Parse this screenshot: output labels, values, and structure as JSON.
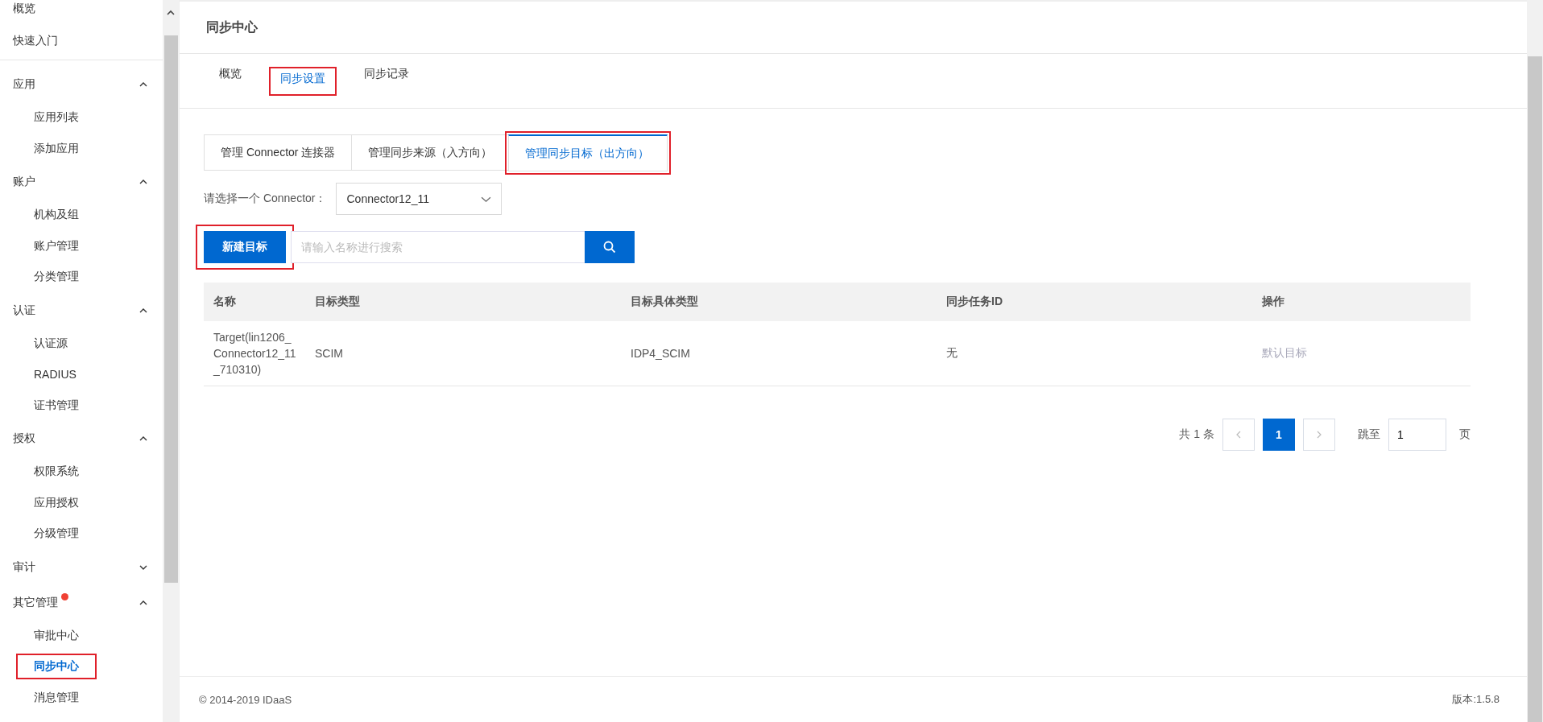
{
  "sidebar": {
    "top_items": [
      {
        "label": "概览"
      },
      {
        "label": "快速入门"
      }
    ],
    "groups": [
      {
        "label": "应用",
        "expanded": true,
        "badge": false,
        "items": [
          {
            "label": "应用列表",
            "selected": false,
            "highlighted": false
          },
          {
            "label": "添加应用",
            "selected": false,
            "highlighted": false
          }
        ]
      },
      {
        "label": "账户",
        "expanded": true,
        "badge": false,
        "items": [
          {
            "label": "机构及组",
            "selected": false,
            "highlighted": false
          },
          {
            "label": "账户管理",
            "selected": false,
            "highlighted": false
          },
          {
            "label": "分类管理",
            "selected": false,
            "highlighted": false
          }
        ]
      },
      {
        "label": "认证",
        "expanded": true,
        "badge": false,
        "items": [
          {
            "label": "认证源",
            "selected": false,
            "highlighted": false
          },
          {
            "label": "RADIUS",
            "selected": false,
            "highlighted": false
          },
          {
            "label": "证书管理",
            "selected": false,
            "highlighted": false
          }
        ]
      },
      {
        "label": "授权",
        "expanded": true,
        "badge": false,
        "items": [
          {
            "label": "权限系统",
            "selected": false,
            "highlighted": false
          },
          {
            "label": "应用授权",
            "selected": false,
            "highlighted": false
          },
          {
            "label": "分级管理",
            "selected": false,
            "highlighted": false
          }
        ]
      },
      {
        "label": "审计",
        "expanded": false,
        "badge": false
      },
      {
        "label": "其它管理",
        "expanded": true,
        "badge": true,
        "items": [
          {
            "label": "审批中心",
            "selected": false,
            "highlighted": false
          },
          {
            "label": "同步中心",
            "selected": true,
            "highlighted": true
          },
          {
            "label": "消息管理",
            "selected": false,
            "highlighted": false
          }
        ]
      }
    ]
  },
  "page": {
    "title": "同步中心",
    "tabs": [
      {
        "label": "概览",
        "selected": false,
        "highlighted": false
      },
      {
        "label": "同步设置",
        "selected": true,
        "highlighted": true
      },
      {
        "label": "同步记录",
        "selected": false,
        "highlighted": false
      }
    ],
    "sub_tabs": [
      {
        "label": "管理 Connector 连接器",
        "selected": false,
        "highlighted": false
      },
      {
        "label": "管理同步来源（入方向）",
        "selected": false,
        "highlighted": false
      },
      {
        "label": "管理同步目标（出方向）",
        "selected": true,
        "highlighted": true
      }
    ],
    "connector_label": "请选择一个 Connector：",
    "connector_value": "Connector12_11",
    "new_button": {
      "label": "新建目标",
      "highlighted": true
    },
    "search": {
      "placeholder": "请输入名称进行搜索"
    },
    "table": {
      "columns": [
        "名称",
        "目标类型",
        "目标具体类型",
        "同步任务ID",
        "操作"
      ],
      "rows": [
        {
          "cells": [
            "Target(lin1206_Connector12_11_710310)",
            "SCIM",
            "IDP4_SCIM",
            "无"
          ],
          "action": "默认目标"
        }
      ]
    },
    "pagination": {
      "total": "共 1 条",
      "pages": [
        {
          "label": "1",
          "selected": true
        }
      ],
      "jump_label": "跳至",
      "jump_value": "1",
      "page_unit": "页"
    }
  },
  "footer": {
    "copyright": "© 2014-2019 IDaaS",
    "version": "版本:1.5.8"
  }
}
